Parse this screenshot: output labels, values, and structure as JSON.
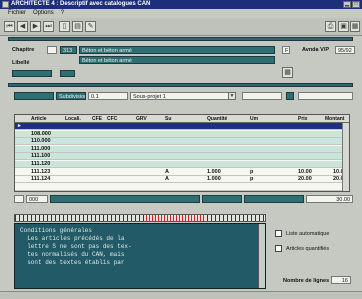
{
  "window": {
    "title": "ARCHITECTE 4 : Descriptif avec catalogues CAN"
  },
  "menu": [
    "Fichier",
    "Options",
    "?"
  ],
  "toolbar": {
    "first_icon": "first-record-icon",
    "prev_icon": "previous-record-icon",
    "next_icon": "next-record-icon",
    "last_icon": "last-record-icon",
    "new_icon": "new-document-icon",
    "open_icon": "open-document-icon",
    "edit_icon": "edit-icon"
  },
  "header": {
    "chapitre_label": "Chapitre",
    "chapitre_code": "313",
    "chapitre_value": "Béton et béton armé",
    "chapitre_value2": "Béton et béton armé",
    "libelle_label": "Libellé",
    "flag": "F",
    "avenda_label": "Avnda V/P",
    "avenda_value": "95/92"
  },
  "filter": {
    "label": "Subdivision",
    "code": "0.1",
    "value": "Sous-projet 1"
  },
  "grid": {
    "columns": [
      "Article",
      "Locali.",
      "CFE",
      "CFC",
      "GRV",
      "Su",
      "Quantité",
      "Um",
      "Prix",
      "Montant"
    ],
    "rows": [
      {
        "article": "",
        "su": "",
        "qty": "",
        "um": "",
        "prix": "",
        "montant": ""
      },
      {
        "article": "108.000",
        "su": "",
        "qty": "",
        "um": "",
        "prix": "",
        "montant": ""
      },
      {
        "article": "110.000",
        "su": "",
        "qty": "",
        "um": "",
        "prix": "",
        "montant": ""
      },
      {
        "article": "111.000",
        "su": "",
        "qty": "",
        "um": "",
        "prix": "",
        "montant": ""
      },
      {
        "article": "111.100",
        "su": "",
        "qty": "",
        "um": "",
        "prix": "",
        "montant": ""
      },
      {
        "article": "111.120",
        "su": "",
        "qty": "",
        "um": "",
        "prix": "",
        "montant": ""
      },
      {
        "article": "111.123",
        "su": "A",
        "qty": "1.000",
        "um": "p",
        "prix": "10.00",
        "montant": "10.00"
      },
      {
        "article": "111.124",
        "su": "A",
        "qty": "1.000",
        "um": "p",
        "prix": "20.00",
        "montant": "20.00"
      },
      {
        "article": "",
        "su": "",
        "qty": "",
        "um": "",
        "prix": "",
        "montant": ""
      }
    ]
  },
  "summary": {
    "code": "000",
    "amount": "30.00"
  },
  "memo": {
    "lines": [
      "Conditions générales",
      "",
      "  Les articles précédés de la",
      "  lettre S ne sont pas des tex-",
      "  tes normalisés du CAN, mais",
      "  sont des textes établis par"
    ]
  },
  "options": {
    "liste_auto": "Liste automatique",
    "articles_quant": "Articles quantifiés",
    "nb_lignes_label": "Nombre de lignes :",
    "nb_lignes_value": "16"
  }
}
